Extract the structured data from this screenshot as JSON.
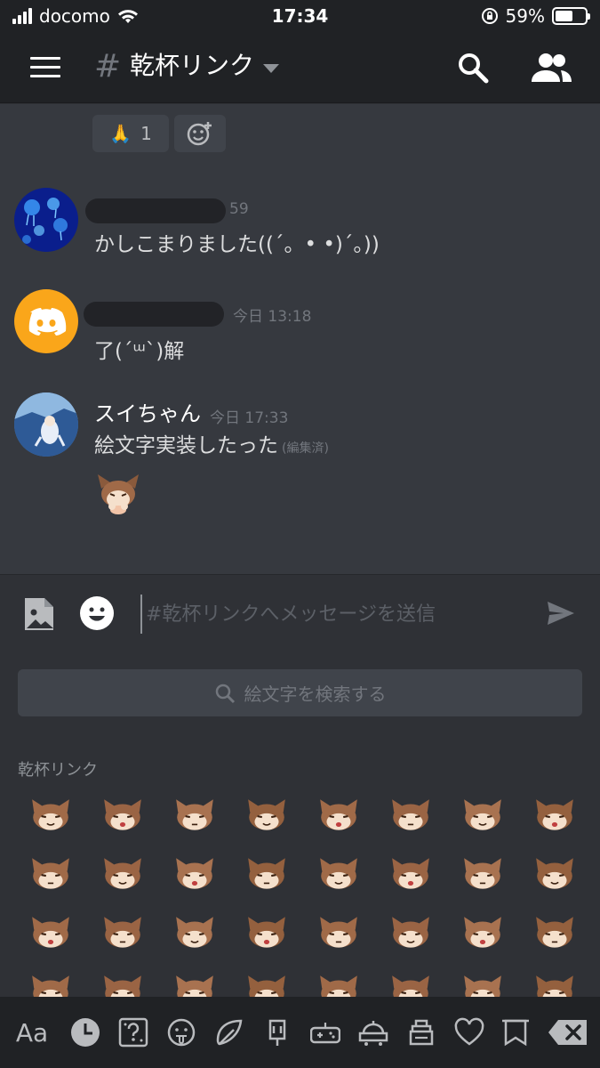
{
  "status_bar": {
    "carrier": "docomo",
    "time": "17:34",
    "battery_percent": "59%",
    "battery_level": 0.59
  },
  "header": {
    "hash": "#",
    "channel_name": "乾杯リンク"
  },
  "reactions": [
    {
      "emoji": "🙏",
      "count": "1"
    }
  ],
  "messages": [
    {
      "author": "",
      "time": "59",
      "text": "かしこまりました((´。• •)´。))",
      "avatar": "jellyfish-avatar"
    },
    {
      "author": "",
      "time": "今日 13:18",
      "text": "了(´ᵚ`)解",
      "avatar": "discord-logo-avatar"
    },
    {
      "author": "スイちゃん",
      "time": "今日 17:33",
      "text": "絵文字実装したった",
      "edited": "(編集済)",
      "avatar": "anime-girl-avatar"
    }
  ],
  "input": {
    "placeholder": "#乾杯リンクへメッセージを送信"
  },
  "emoji_picker": {
    "search_placeholder": "絵文字を検索する",
    "section_title": "乾杯リンク",
    "emoji_count": 32
  },
  "tabs": {
    "text_tab": "Aa"
  },
  "colors": {
    "background": "#36393f",
    "header": "#202225",
    "accent": "#7289da",
    "discord_orange": "#faa61a"
  }
}
